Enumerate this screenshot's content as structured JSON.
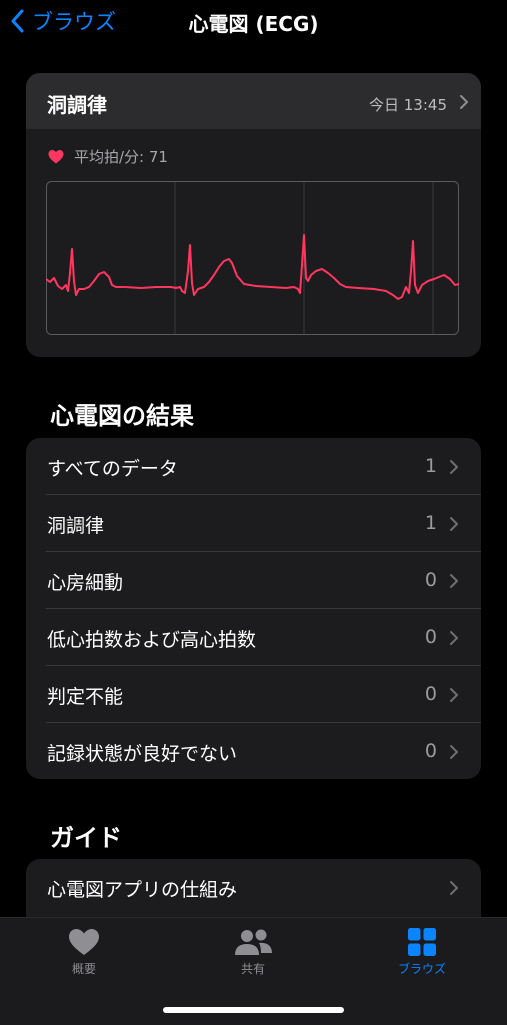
{
  "nav": {
    "back_label": "ブラウズ",
    "title": "心電図 (ECG)"
  },
  "ecg_card": {
    "title": "洞調律",
    "date": "今日 13:45",
    "heart_rate_label": "平均拍/分: 71",
    "accent_color": "#ff375f"
  },
  "results": {
    "header": "心電図の結果",
    "items": [
      {
        "label": "すべてのデータ",
        "value": "1"
      },
      {
        "label": "洞調律",
        "value": "1"
      },
      {
        "label": "心房細動",
        "value": "0"
      },
      {
        "label": "低心拍数および高心拍数",
        "value": "0"
      },
      {
        "label": "判定不能",
        "value": "0"
      },
      {
        "label": "記録状態が良好でない",
        "value": "0"
      }
    ]
  },
  "guide": {
    "header": "ガイド",
    "items": [
      {
        "label": "心電図アプリの仕組み"
      }
    ]
  },
  "tabbar": {
    "items": [
      {
        "label": "概要",
        "icon": "heart-icon"
      },
      {
        "label": "共有",
        "icon": "people-icon"
      },
      {
        "label": "ブラウズ",
        "icon": "grid-icon",
        "active": true
      }
    ]
  }
}
